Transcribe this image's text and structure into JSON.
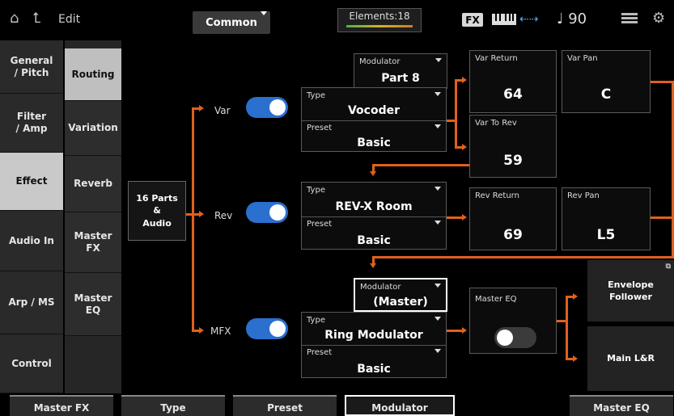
{
  "topbar": {
    "edit_label": "Edit",
    "common_label": "Common",
    "elements_label": "Elements:18",
    "fx_badge": "FX",
    "tempo": "♩ 90"
  },
  "categories": [
    {
      "label": "General\n/ Pitch",
      "selected": false
    },
    {
      "label": "Filter\n/ Amp",
      "selected": false
    },
    {
      "label": "Effect",
      "selected": true
    },
    {
      "label": "Audio In",
      "selected": false
    },
    {
      "label": "Arp / MS",
      "selected": false
    },
    {
      "label": "Control",
      "selected": false
    }
  ],
  "subtabs": [
    {
      "label": "Routing",
      "selected": true
    },
    {
      "label": "Variation",
      "selected": false
    },
    {
      "label": "Reverb",
      "selected": false
    },
    {
      "label": "Master\nFX",
      "selected": false
    },
    {
      "label": "Master\nEQ",
      "selected": false
    }
  ],
  "source": {
    "label": "16 Parts\n&\nAudio"
  },
  "var": {
    "switch_label": "Var",
    "modulator_label": "Modulator",
    "modulator_value": "Part 8",
    "type_label": "Type",
    "type_value": "Vocoder",
    "preset_label": "Preset",
    "preset_value": "Basic",
    "return_label": "Var Return",
    "return_value": "64",
    "pan_label": "Var Pan",
    "pan_value": "C",
    "to_rev_label": "Var To Rev",
    "to_rev_value": "59"
  },
  "rev": {
    "switch_label": "Rev",
    "type_label": "Type",
    "type_value": "REV-X Room",
    "preset_label": "Preset",
    "preset_value": "Basic",
    "return_label": "Rev Return",
    "return_value": "69",
    "pan_label": "Rev Pan",
    "pan_value": "L5"
  },
  "mfx": {
    "switch_label": "MFX",
    "modulator_label": "Modulator",
    "modulator_value": "(Master)",
    "type_label": "Type",
    "type_value": "Ring Modulator",
    "preset_label": "Preset",
    "preset_value": "Basic"
  },
  "master_eq": {
    "label": "Master EQ"
  },
  "envelope_follower": {
    "label": "Envelope\nFollower"
  },
  "main_out": {
    "label": "Main L&R"
  },
  "bottom": [
    "Master FX",
    "Type",
    "Preset",
    "Modulator",
    "",
    "Master EQ"
  ],
  "colors": {
    "accent": "#e0601f",
    "toggle_on": "#2b6fcf"
  }
}
